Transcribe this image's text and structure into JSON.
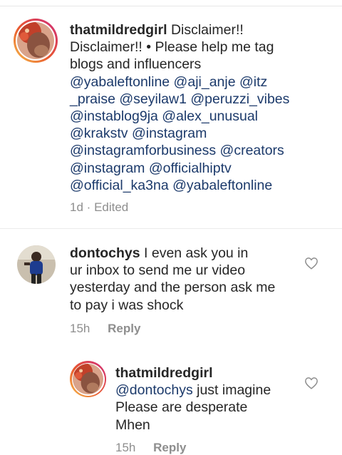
{
  "comments": [
    {
      "username": "thatmildredgirl",
      "line1_rest": "Disclaimer!!",
      "line2": "Disclaimer!! • Please help me tag",
      "line3": "blogs and influencers",
      "mentions": [
        "@yabaleftonline @aji_anje @itz",
        "_praise @seyilaw1 @peruzzi_vibes",
        "@instablog9ja @alex_unusual",
        "@krakstv @instagram",
        "@instagramforbusiness @creators",
        "@instagram @officialhiptv",
        "@official_ka3na @yabaleftonline"
      ],
      "time": "1d",
      "dot": "·",
      "edited": "Edited"
    },
    {
      "username": "dontochys",
      "line1_rest": "I even ask you in",
      "lines": [
        "ur inbox  to send me ur video",
        "yesterday and the person ask me",
        "to pay i was shock"
      ],
      "time": "15h",
      "reply_label": "Reply",
      "heart_icon": "heart-outline-icon"
    },
    {
      "username": "thatmildredgirl",
      "mention": "@dontochys",
      "line1_rest": "just imagine",
      "lines": [
        "Please are desperate",
        "Mhen"
      ],
      "time": "15h",
      "reply_label": "Reply",
      "heart_icon": "heart-outline-icon"
    }
  ]
}
